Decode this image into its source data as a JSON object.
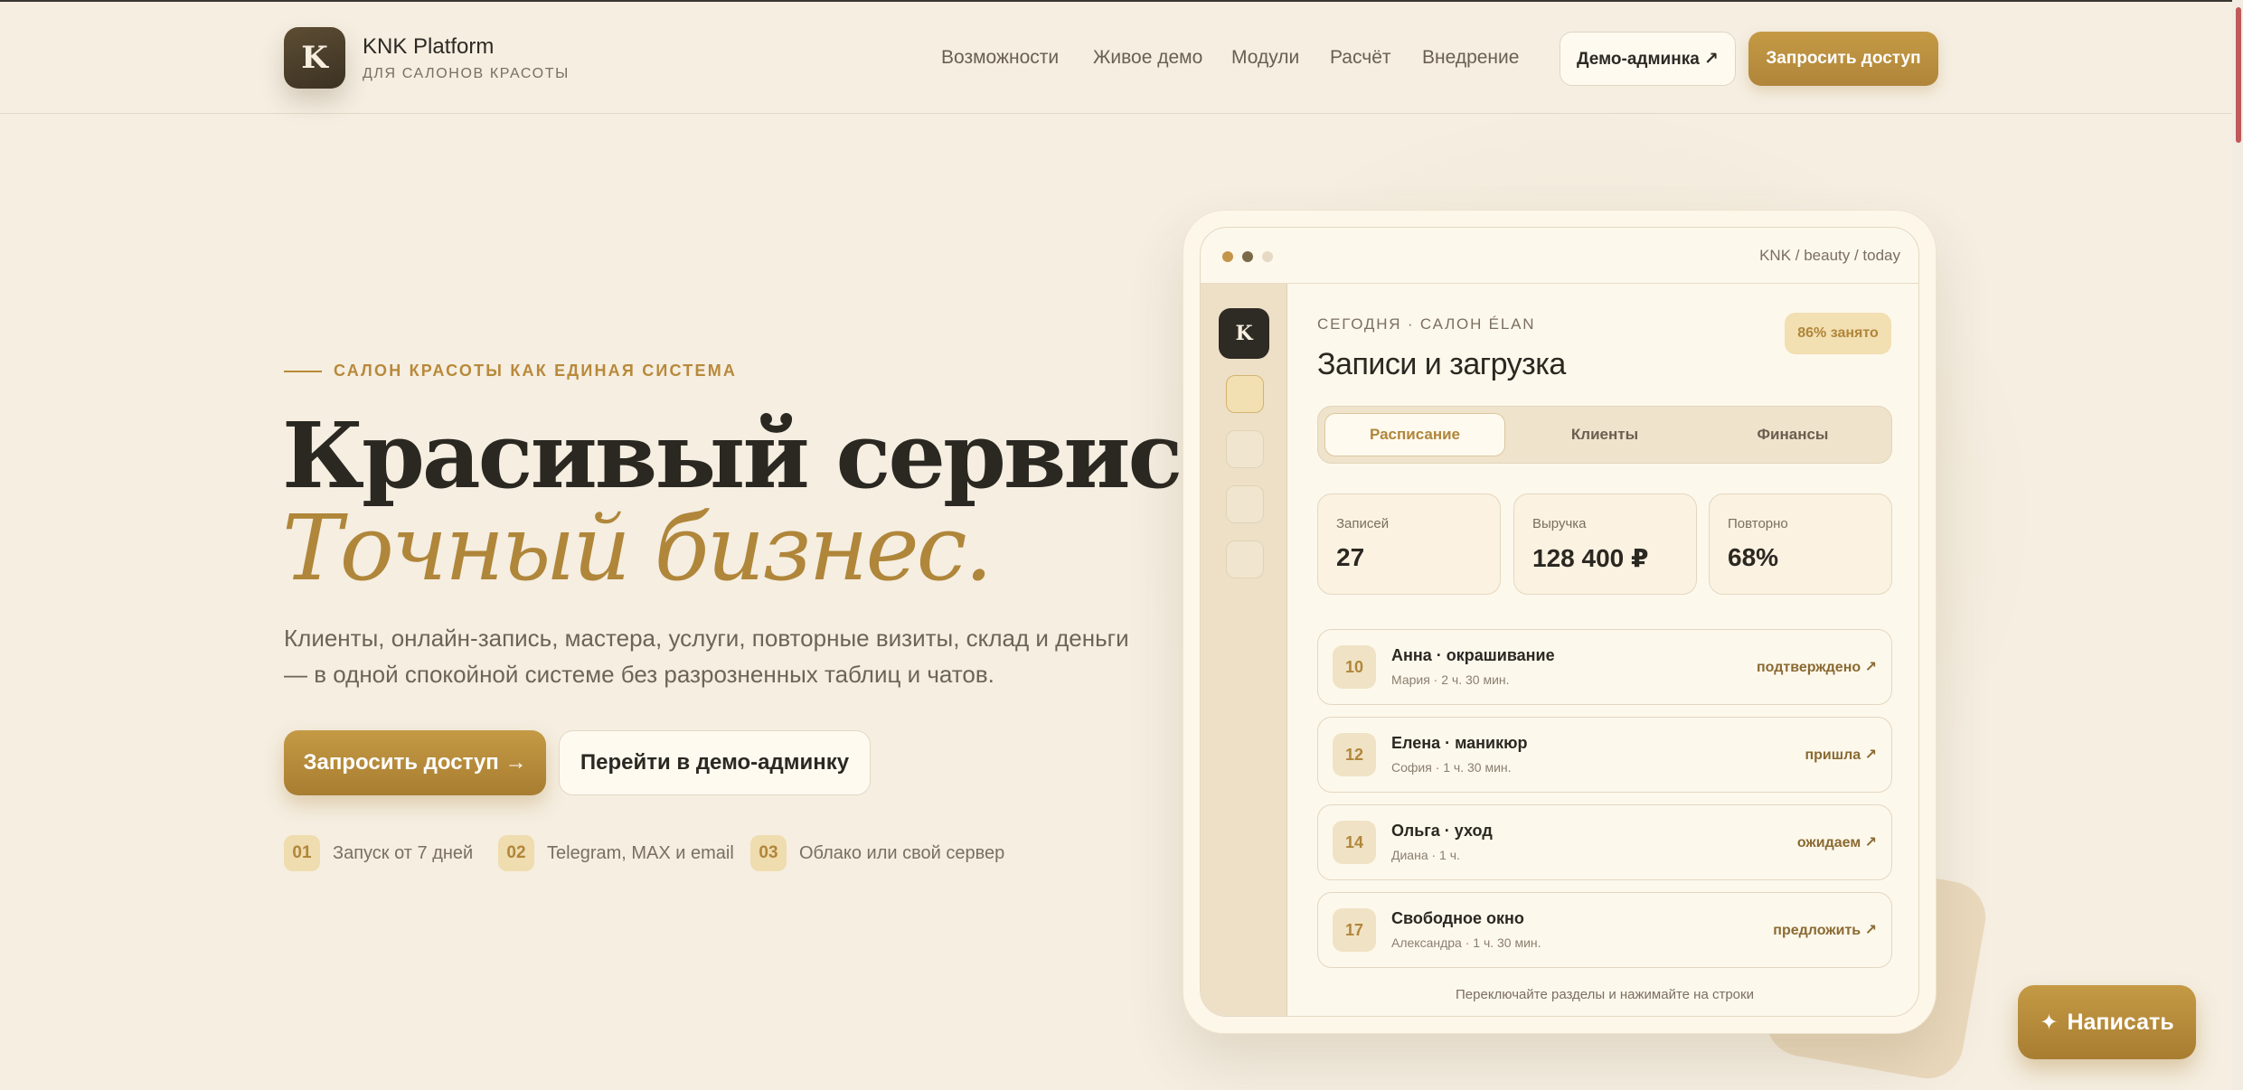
{
  "header": {
    "logo_letter": "K",
    "brand_name": "KNK Platform",
    "brand_sub": "ДЛЯ САЛОНОВ КРАСОТЫ",
    "nav": [
      "Возможности",
      "Живое демо",
      "Модули",
      "Расчёт",
      "Внедрение"
    ],
    "demo_admin": "Демо-админка ↗",
    "request_access": "Запросить доступ"
  },
  "hero": {
    "eyebrow": "САЛОН КРАСОТЫ КАК ЕДИНАЯ СИСТЕМА",
    "title_line1": "Красивый сервис.",
    "title_line2": "Точный бизнес.",
    "lead": "Клиенты, онлайн-запись, мастера, услуги, повторные визиты, склад и деньги — в одной спокойной системе без разрозненных таблиц и чатов.",
    "cta_primary": "Запросить доступ →",
    "cta_secondary": "Перейти в демо-админку",
    "features": [
      {
        "num": "01",
        "text": "Запуск от 7 дней"
      },
      {
        "num": "02",
        "text": "Telegram, MAX и email"
      },
      {
        "num": "03",
        "text": "Облако или свой сервер"
      }
    ]
  },
  "mockup": {
    "crumb": "KNK / beauty / today",
    "side_letter": "K",
    "eyebrow": "СЕГОДНЯ · САЛОН ÉLAN",
    "title": "Записи и загрузка",
    "badge": "86% занято",
    "tabs": [
      "Расписание",
      "Клиенты",
      "Финансы"
    ],
    "stats": [
      {
        "label": "Записей",
        "value": "27"
      },
      {
        "label": "Выручка",
        "value": "128 400 ₽"
      },
      {
        "label": "Повторно",
        "value": "68%"
      }
    ],
    "rows": [
      {
        "time": "10",
        "title": "Анна · окрашивание",
        "sub": "Мария · 2 ч. 30 мин.",
        "status": "подтверждено ↗"
      },
      {
        "time": "12",
        "title": "Елена · маникюр",
        "sub": "София · 1 ч. 30 мин.",
        "status": "пришла ↗"
      },
      {
        "time": "14",
        "title": "Ольга · уход",
        "sub": "Диана · 1 ч.",
        "status": "ожидаем ↗"
      },
      {
        "time": "17",
        "title": "Свободное окно",
        "sub": "Александра · 1 ч. 30 мин.",
        "status": "предложить ↗"
      }
    ],
    "hint": "Переключайте разделы и нажимайте на строки"
  },
  "chat": {
    "icon": "✦",
    "label": "Написать"
  },
  "colors": {
    "accent": "#b0863a",
    "background": "#f5eee1",
    "dark": "#2b2822"
  }
}
